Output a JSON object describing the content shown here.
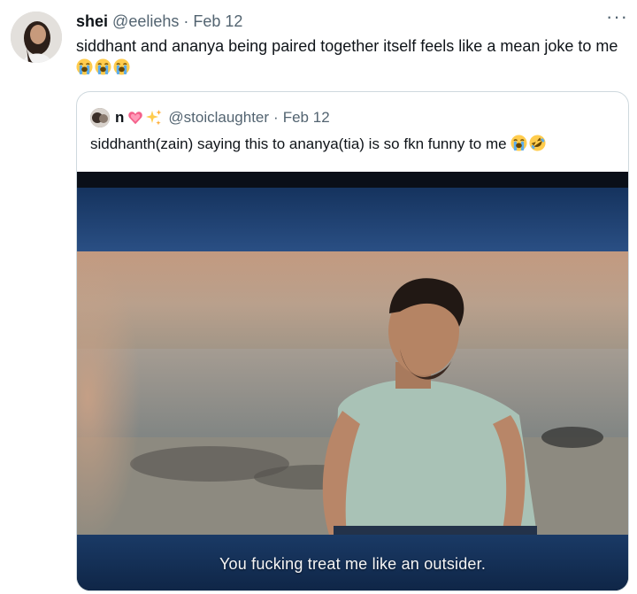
{
  "tweet": {
    "display_name": "shei",
    "handle": "@eeliehs",
    "separator": "·",
    "date": "Feb 12",
    "more_label": "···",
    "text": "siddhant and ananya being paired together itself feels like a mean joke to me",
    "emojis": [
      "loudly-crying-face",
      "loudly-crying-face",
      "loudly-crying-face"
    ]
  },
  "quoted": {
    "display_name": "n",
    "name_emojis": [
      "sparkling-heart",
      "sparkles"
    ],
    "handle": "@stoiclaughter",
    "separator": "·",
    "date": "Feb 12",
    "text": "siddhanth(zain) saying this to ananya(tia) is so fkn funny to me",
    "emojis": [
      "loudly-crying-face",
      "rolling-on-floor-laughing"
    ],
    "media": {
      "subtitle": "You fucking treat me like an outsider."
    }
  },
  "colors": {
    "text_primary": "#0f1419",
    "text_secondary": "#536471",
    "border": "#cfd9de"
  }
}
